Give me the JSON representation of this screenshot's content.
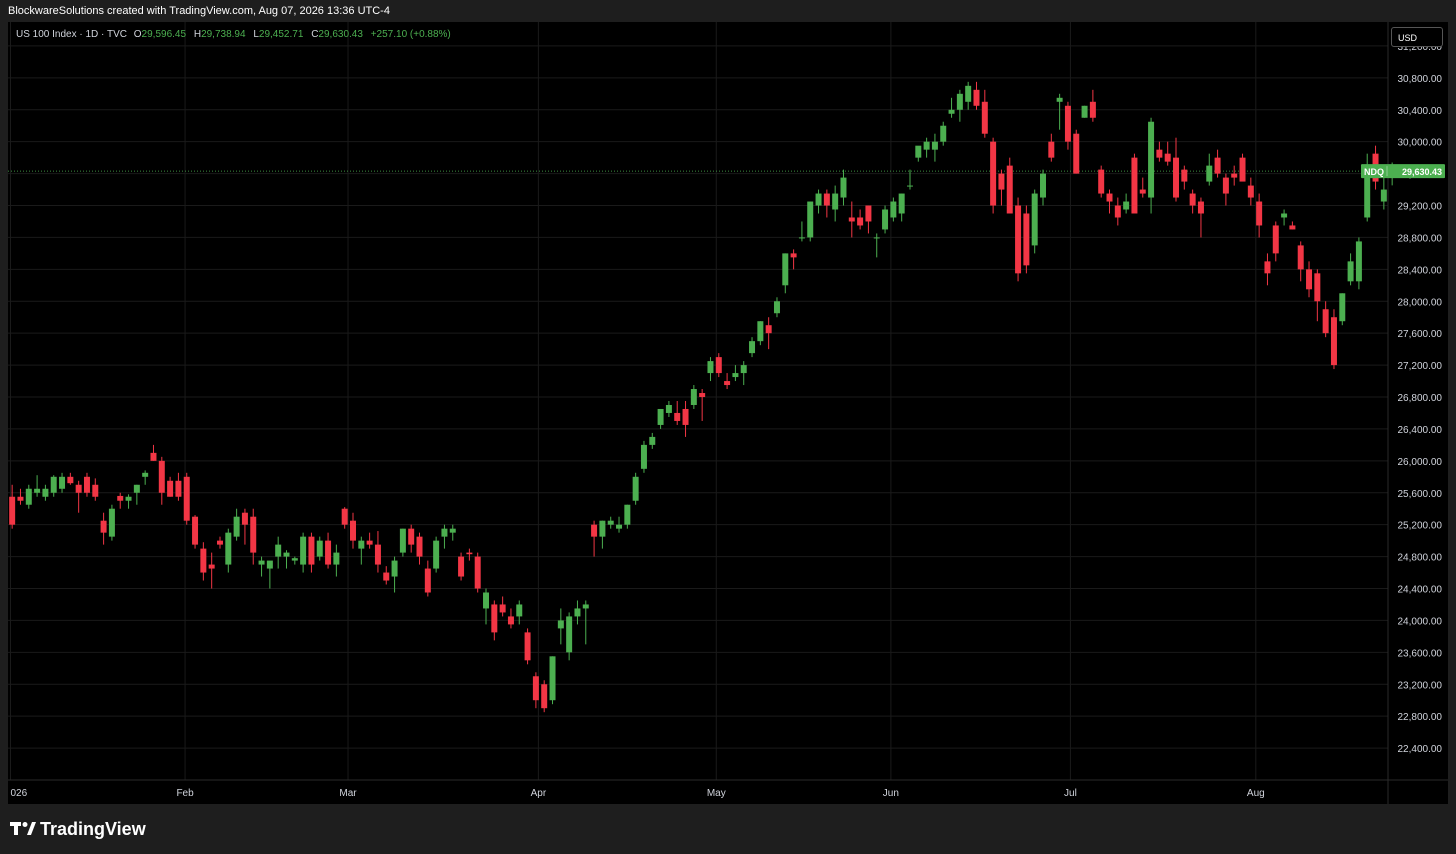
{
  "header": {
    "attribution": "BlockwareSolutions created with TradingView.com, Aug 07, 2026 13:36 UTC-4"
  },
  "legend": {
    "symbol": "US 100 Index · 1D · TVC",
    "open_label": "O",
    "open": "29,596.45",
    "high_label": "H",
    "high": "29,738.94",
    "low_label": "L",
    "low": "29,452.71",
    "close_label": "C",
    "close": "29,630.43",
    "change": "+257.10 (+0.88%)"
  },
  "currency": "USD",
  "price_tag": {
    "ticker": "NDQ",
    "price": "29,630.43"
  },
  "footer": {
    "brand": "TradingView"
  },
  "colors": {
    "up": "#4caf50",
    "down": "#f23645",
    "background": "#000000",
    "grid": "#1a1a1a",
    "axis_text": "#d1d4dc"
  },
  "chart_data": {
    "type": "candlestick",
    "y_axis": {
      "ticks": [
        31200,
        30800,
        30400,
        30000,
        29600,
        29200,
        28800,
        28400,
        28000,
        27600,
        27200,
        26800,
        26400,
        26000,
        25600,
        25200,
        24800,
        24400,
        24000,
        23600,
        23200,
        22800,
        22400
      ],
      "tick_labels": [
        "31,200.00",
        "30,800.00",
        "30,400.00",
        "30,000.00",
        "29,600.00",
        "29,200.00",
        "28,800.00",
        "28,400.00",
        "28,000.00",
        "27,600.00",
        "27,200.00",
        "26,800.00",
        "26,400.00",
        "26,000.00",
        "25,600.00",
        "25,200.00",
        "24,800.00",
        "24,400.00",
        "24,000.00",
        "23,600.00",
        "23,200.00",
        "22,800.00",
        "22,400.00"
      ],
      "range": [
        22000,
        31500
      ]
    },
    "x_axis": {
      "labels": [
        {
          "label": "026",
          "index": -0.2
        },
        {
          "label": "Feb",
          "index": 20.8
        },
        {
          "label": "Mar",
          "index": 40.4
        },
        {
          "label": "Apr",
          "index": 63.3
        },
        {
          "label": "May",
          "index": 84.7
        },
        {
          "label": "Jun",
          "index": 105.7
        },
        {
          "label": "Jul",
          "index": 127.3
        },
        {
          "label": "Aug",
          "index": 149.6
        }
      ],
      "slots": 166
    },
    "last_price": 29630.43,
    "candles": [
      {
        "o": 25550,
        "h": 25700,
        "l": 25150,
        "c": 25200
      },
      {
        "o": 25550,
        "h": 25650,
        "l": 25450,
        "c": 25500
      },
      {
        "o": 25450,
        "h": 25700,
        "l": 25400,
        "c": 25650
      },
      {
        "o": 25600,
        "h": 25820,
        "l": 25550,
        "c": 25650
      },
      {
        "o": 25550,
        "h": 25700,
        "l": 25500,
        "c": 25650
      },
      {
        "o": 25600,
        "h": 25820,
        "l": 25550,
        "c": 25800
      },
      {
        "o": 25650,
        "h": 25850,
        "l": 25600,
        "c": 25800
      },
      {
        "o": 25800,
        "h": 25850,
        "l": 25700,
        "c": 25720
      },
      {
        "o": 25700,
        "h": 25750,
        "l": 25350,
        "c": 25600
      },
      {
        "o": 25800,
        "h": 25850,
        "l": 25550,
        "c": 25600
      },
      {
        "o": 25700,
        "h": 25780,
        "l": 25500,
        "c": 25550
      },
      {
        "o": 25250,
        "h": 25350,
        "l": 24950,
        "c": 25100
      },
      {
        "o": 25050,
        "h": 25450,
        "l": 25000,
        "c": 25400
      },
      {
        "o": 25560,
        "h": 25600,
        "l": 25400,
        "c": 25500
      },
      {
        "o": 25500,
        "h": 25580,
        "l": 25400,
        "c": 25550
      },
      {
        "o": 25600,
        "h": 25700,
        "l": 25450,
        "c": 25700
      },
      {
        "o": 25800,
        "h": 25880,
        "l": 25700,
        "c": 25850
      },
      {
        "o": 26100,
        "h": 26200,
        "l": 26000,
        "c": 26000
      },
      {
        "o": 26000,
        "h": 26050,
        "l": 25450,
        "c": 25600
      },
      {
        "o": 25750,
        "h": 25800,
        "l": 25550,
        "c": 25550
      },
      {
        "o": 25750,
        "h": 25850,
        "l": 25500,
        "c": 25550
      },
      {
        "o": 25800,
        "h": 25850,
        "l": 25200,
        "c": 25250
      },
      {
        "o": 25300,
        "h": 25320,
        "l": 24900,
        "c": 24950
      },
      {
        "o": 24900,
        "h": 24980,
        "l": 24500,
        "c": 24600
      },
      {
        "o": 24700,
        "h": 24850,
        "l": 24400,
        "c": 24650
      },
      {
        "o": 25000,
        "h": 25050,
        "l": 24900,
        "c": 24950
      },
      {
        "o": 24700,
        "h": 25150,
        "l": 24600,
        "c": 25100
      },
      {
        "o": 25050,
        "h": 25400,
        "l": 25000,
        "c": 25300
      },
      {
        "o": 25350,
        "h": 25400,
        "l": 24950,
        "c": 25200
      },
      {
        "o": 25300,
        "h": 25400,
        "l": 24700,
        "c": 24850
      },
      {
        "o": 24700,
        "h": 24800,
        "l": 24550,
        "c": 24750
      },
      {
        "o": 24650,
        "h": 24700,
        "l": 24400,
        "c": 24750
      },
      {
        "o": 24800,
        "h": 25050,
        "l": 24650,
        "c": 24950
      },
      {
        "o": 24800,
        "h": 24880,
        "l": 24650,
        "c": 24850
      },
      {
        "o": 24750,
        "h": 24800,
        "l": 24700,
        "c": 24780
      },
      {
        "o": 24700,
        "h": 25100,
        "l": 24600,
        "c": 25050
      },
      {
        "o": 25050,
        "h": 25100,
        "l": 24600,
        "c": 24700
      },
      {
        "o": 24800,
        "h": 25050,
        "l": 24750,
        "c": 25000
      },
      {
        "o": 25000,
        "h": 25100,
        "l": 24650,
        "c": 24700
      },
      {
        "o": 24700,
        "h": 24950,
        "l": 24550,
        "c": 24850
      },
      {
        "o": 25400,
        "h": 25420,
        "l": 25150,
        "c": 25200
      },
      {
        "o": 25250,
        "h": 25350,
        "l": 24900,
        "c": 25000
      },
      {
        "o": 24900,
        "h": 25050,
        "l": 24700,
        "c": 25000
      },
      {
        "o": 25000,
        "h": 25100,
        "l": 24900,
        "c": 24950
      },
      {
        "o": 24950,
        "h": 25120,
        "l": 24600,
        "c": 24700
      },
      {
        "o": 24600,
        "h": 24680,
        "l": 24450,
        "c": 24500
      },
      {
        "o": 24550,
        "h": 24800,
        "l": 24350,
        "c": 24750
      },
      {
        "o": 24850,
        "h": 25150,
        "l": 24800,
        "c": 25150
      },
      {
        "o": 25150,
        "h": 25200,
        "l": 24850,
        "c": 24950
      },
      {
        "o": 25050,
        "h": 25100,
        "l": 24700,
        "c": 24800
      },
      {
        "o": 24650,
        "h": 24750,
        "l": 24300,
        "c": 24350
      },
      {
        "o": 24650,
        "h": 25050,
        "l": 24600,
        "c": 25000
      },
      {
        "o": 25050,
        "h": 25200,
        "l": 24900,
        "c": 25150
      },
      {
        "o": 25100,
        "h": 25200,
        "l": 25000,
        "c": 25150
      },
      {
        "o": 24800,
        "h": 24850,
        "l": 24500,
        "c": 24550
      },
      {
        "o": 24850,
        "h": 24900,
        "l": 24750,
        "c": 24830
      },
      {
        "o": 24800,
        "h": 24850,
        "l": 24350,
        "c": 24400
      },
      {
        "o": 24150,
        "h": 24400,
        "l": 23950,
        "c": 24350
      },
      {
        "o": 24200,
        "h": 24250,
        "l": 23750,
        "c": 23850
      },
      {
        "o": 24200,
        "h": 24300,
        "l": 24050,
        "c": 24100
      },
      {
        "o": 24050,
        "h": 24150,
        "l": 23900,
        "c": 23950
      },
      {
        "o": 24050,
        "h": 24250,
        "l": 23950,
        "c": 24200
      },
      {
        "o": 23850,
        "h": 23900,
        "l": 23450,
        "c": 23500
      },
      {
        "o": 23300,
        "h": 23350,
        "l": 22900,
        "c": 23000
      },
      {
        "o": 23200,
        "h": 23250,
        "l": 22850,
        "c": 22900
      },
      {
        "o": 23000,
        "h": 23550,
        "l": 22950,
        "c": 23550
      },
      {
        "o": 23900,
        "h": 24150,
        "l": 23700,
        "c": 24000
      },
      {
        "o": 23600,
        "h": 24100,
        "l": 23500,
        "c": 24050
      },
      {
        "o": 24050,
        "h": 24250,
        "l": 23950,
        "c": 24150
      },
      {
        "o": 24150,
        "h": 24250,
        "l": 23700,
        "c": 24200
      },
      {
        "o": 25200,
        "h": 25250,
        "l": 24800,
        "c": 25050
      },
      {
        "o": 25050,
        "h": 25250,
        "l": 24900,
        "c": 25250
      },
      {
        "o": 25200,
        "h": 25300,
        "l": 25150,
        "c": 25250
      },
      {
        "o": 25150,
        "h": 25300,
        "l": 25100,
        "c": 25200
      },
      {
        "o": 25200,
        "h": 25450,
        "l": 25150,
        "c": 25450
      },
      {
        "o": 25500,
        "h": 25850,
        "l": 25450,
        "c": 25800
      },
      {
        "o": 25900,
        "h": 26250,
        "l": 25850,
        "c": 26200
      },
      {
        "o": 26200,
        "h": 26350,
        "l": 26150,
        "c": 26300
      },
      {
        "o": 26450,
        "h": 26650,
        "l": 26400,
        "c": 26650
      },
      {
        "o": 26600,
        "h": 26750,
        "l": 26550,
        "c": 26700
      },
      {
        "o": 26600,
        "h": 26750,
        "l": 26450,
        "c": 26500
      },
      {
        "o": 26650,
        "h": 26750,
        "l": 26300,
        "c": 26450
      },
      {
        "o": 26700,
        "h": 26950,
        "l": 26650,
        "c": 26900
      },
      {
        "o": 26850,
        "h": 26900,
        "l": 26500,
        "c": 26800
      },
      {
        "o": 27100,
        "h": 27300,
        "l": 27000,
        "c": 27250
      },
      {
        "o": 27300,
        "h": 27350,
        "l": 27050,
        "c": 27100
      },
      {
        "o": 27000,
        "h": 27100,
        "l": 26900,
        "c": 26950
      },
      {
        "o": 27050,
        "h": 27200,
        "l": 27000,
        "c": 27100
      },
      {
        "o": 27100,
        "h": 27250,
        "l": 26950,
        "c": 27200
      },
      {
        "o": 27350,
        "h": 27550,
        "l": 27300,
        "c": 27500
      },
      {
        "o": 27500,
        "h": 27750,
        "l": 27450,
        "c": 27750
      },
      {
        "o": 27700,
        "h": 27800,
        "l": 27400,
        "c": 27600
      },
      {
        "o": 27850,
        "h": 28050,
        "l": 27800,
        "c": 28000
      },
      {
        "o": 28200,
        "h": 28600,
        "l": 28100,
        "c": 28600
      },
      {
        "o": 28600,
        "h": 28650,
        "l": 28400,
        "c": 28550
      },
      {
        "o": 28800,
        "h": 29000,
        "l": 28750,
        "c": 28800
      },
      {
        "o": 28800,
        "h": 29250,
        "l": 28750,
        "c": 29250
      },
      {
        "o": 29200,
        "h": 29400,
        "l": 29100,
        "c": 29350
      },
      {
        "o": 29350,
        "h": 29400,
        "l": 29050,
        "c": 29200
      },
      {
        "o": 29150,
        "h": 29450,
        "l": 29000,
        "c": 29350
      },
      {
        "o": 29300,
        "h": 29650,
        "l": 29200,
        "c": 29550
      },
      {
        "o": 29050,
        "h": 29250,
        "l": 28800,
        "c": 29000
      },
      {
        "o": 29050,
        "h": 29150,
        "l": 28900,
        "c": 28950
      },
      {
        "o": 29200,
        "h": 29200,
        "l": 28850,
        "c": 29000
      },
      {
        "o": 28800,
        "h": 28850,
        "l": 28550,
        "c": 28800
      },
      {
        "o": 28900,
        "h": 29200,
        "l": 28850,
        "c": 29150
      },
      {
        "o": 29050,
        "h": 29300,
        "l": 29000,
        "c": 29250
      },
      {
        "o": 29100,
        "h": 29350,
        "l": 29000,
        "c": 29350
      },
      {
        "o": 29450,
        "h": 29650,
        "l": 29400,
        "c": 29450
      },
      {
        "o": 29800,
        "h": 29900,
        "l": 29750,
        "c": 29950
      },
      {
        "o": 29900,
        "h": 30050,
        "l": 29800,
        "c": 30000
      },
      {
        "o": 29900,
        "h": 30100,
        "l": 29750,
        "c": 30000
      },
      {
        "o": 30000,
        "h": 30250,
        "l": 29950,
        "c": 30200
      },
      {
        "o": 30350,
        "h": 30550,
        "l": 30300,
        "c": 30400
      },
      {
        "o": 30400,
        "h": 30650,
        "l": 30250,
        "c": 30600
      },
      {
        "o": 30500,
        "h": 30750,
        "l": 30400,
        "c": 30700
      },
      {
        "o": 30650,
        "h": 30750,
        "l": 30400,
        "c": 30450
      },
      {
        "o": 30500,
        "h": 30650,
        "l": 30050,
        "c": 30100
      },
      {
        "o": 30000,
        "h": 30050,
        "l": 29100,
        "c": 29200
      },
      {
        "o": 29600,
        "h": 29650,
        "l": 29200,
        "c": 29400
      },
      {
        "o": 29700,
        "h": 29800,
        "l": 29100,
        "c": 29100
      },
      {
        "o": 29200,
        "h": 29300,
        "l": 28250,
        "c": 28350
      },
      {
        "o": 29100,
        "h": 29200,
        "l": 28350,
        "c": 28450
      },
      {
        "o": 28700,
        "h": 29400,
        "l": 28600,
        "c": 29350
      },
      {
        "o": 29300,
        "h": 29650,
        "l": 29200,
        "c": 29600
      },
      {
        "o": 30000,
        "h": 30100,
        "l": 29750,
        "c": 29800
      },
      {
        "o": 30500,
        "h": 30600,
        "l": 30150,
        "c": 30550
      },
      {
        "o": 30450,
        "h": 30500,
        "l": 29900,
        "c": 30000
      },
      {
        "o": 30100,
        "h": 30150,
        "l": 29600,
        "c": 29600
      },
      {
        "o": 30300,
        "h": 30450,
        "l": 30300,
        "c": 30450
      },
      {
        "o": 30500,
        "h": 30650,
        "l": 30250,
        "c": 30300
      },
      {
        "o": 29650,
        "h": 29700,
        "l": 29300,
        "c": 29350
      },
      {
        "o": 29350,
        "h": 29400,
        "l": 29100,
        "c": 29250
      },
      {
        "o": 29200,
        "h": 29300,
        "l": 28950,
        "c": 29050
      },
      {
        "o": 29150,
        "h": 29350,
        "l": 29100,
        "c": 29250
      },
      {
        "o": 29800,
        "h": 29850,
        "l": 29100,
        "c": 29100
      },
      {
        "o": 29400,
        "h": 29550,
        "l": 29300,
        "c": 29350
      },
      {
        "o": 29300,
        "h": 30300,
        "l": 29100,
        "c": 30250
      },
      {
        "o": 29900,
        "h": 30000,
        "l": 29750,
        "c": 29800
      },
      {
        "o": 29850,
        "h": 30000,
        "l": 29700,
        "c": 29750
      },
      {
        "o": 29800,
        "h": 30050,
        "l": 29250,
        "c": 29300
      },
      {
        "o": 29650,
        "h": 29700,
        "l": 29400,
        "c": 29500
      },
      {
        "o": 29350,
        "h": 29400,
        "l": 29100,
        "c": 29200
      },
      {
        "o": 29250,
        "h": 29300,
        "l": 28800,
        "c": 29100
      },
      {
        "o": 29500,
        "h": 29850,
        "l": 29450,
        "c": 29700
      },
      {
        "o": 29800,
        "h": 29900,
        "l": 29550,
        "c": 29600
      },
      {
        "o": 29550,
        "h": 29600,
        "l": 29200,
        "c": 29350
      },
      {
        "o": 29600,
        "h": 29700,
        "l": 29450,
        "c": 29550
      },
      {
        "o": 29800,
        "h": 29850,
        "l": 29550,
        "c": 29500
      },
      {
        "o": 29450,
        "h": 29550,
        "l": 29200,
        "c": 29300
      },
      {
        "o": 29250,
        "h": 29350,
        "l": 28800,
        "c": 28950
      },
      {
        "o": 28500,
        "h": 28600,
        "l": 28200,
        "c": 28350
      },
      {
        "o": 28950,
        "h": 29000,
        "l": 28500,
        "c": 28600
      },
      {
        "o": 29050,
        "h": 29150,
        "l": 28950,
        "c": 29100
      },
      {
        "o": 28950,
        "h": 29000,
        "l": 28900,
        "c": 28900
      },
      {
        "o": 28700,
        "h": 28750,
        "l": 28250,
        "c": 28400
      },
      {
        "o": 28400,
        "h": 28500,
        "l": 28050,
        "c": 28150
      },
      {
        "o": 28350,
        "h": 28400,
        "l": 27750,
        "c": 28000
      },
      {
        "o": 27900,
        "h": 28000,
        "l": 27550,
        "c": 27600
      },
      {
        "o": 27800,
        "h": 27900,
        "l": 27150,
        "c": 27200
      },
      {
        "o": 27750,
        "h": 28100,
        "l": 27700,
        "c": 28100
      },
      {
        "o": 28250,
        "h": 28600,
        "l": 28200,
        "c": 28500
      },
      {
        "o": 28250,
        "h": 28800,
        "l": 28150,
        "c": 28750
      },
      {
        "o": 29050,
        "h": 29850,
        "l": 29000,
        "c": 29700
      },
      {
        "o": 29850,
        "h": 29950,
        "l": 29400,
        "c": 29500
      },
      {
        "o": 29250,
        "h": 29600,
        "l": 29150,
        "c": 29400
      },
      {
        "o": 29596.45,
        "h": 29738.94,
        "l": 29452.71,
        "c": 29630.43
      }
    ]
  }
}
